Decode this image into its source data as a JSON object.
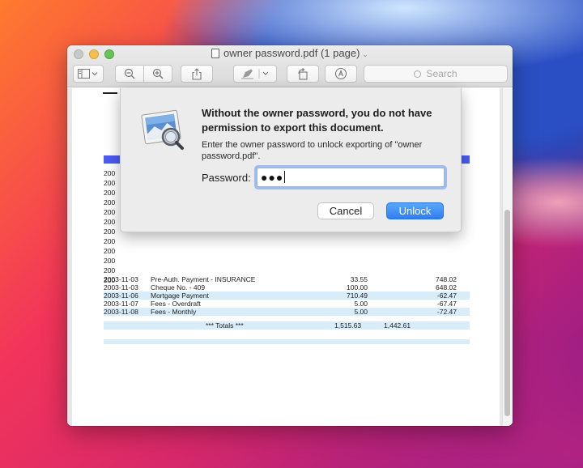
{
  "window": {
    "title": "owner password.pdf (1 page)",
    "search_placeholder": "Search"
  },
  "toolbar": {
    "sidebar_icon": "sidebar-icon",
    "zoom_out_icon": "zoom-out-icon",
    "zoom_in_icon": "zoom-in-icon",
    "share_icon": "share-icon",
    "markup_icon": "highlighter-icon",
    "rotate_icon": "rotate-icon",
    "annotate_icon": "markup-pen-icon"
  },
  "dialog": {
    "title": "Without the owner password, you do not have permission to export this document.",
    "message": "Enter the owner password to unlock exporting of \"owner password.pdf\".",
    "password_label": "Password:",
    "password_value": "●●●",
    "cancel_label": "Cancel",
    "unlock_label": "Unlock"
  },
  "document": {
    "hidden_rows_prefix": [
      "200",
      "200",
      "200",
      "200",
      "200",
      "200",
      "200",
      "200",
      "200",
      "200",
      "200",
      "200"
    ],
    "rows": [
      {
        "date": "2003-11-03",
        "desc": "Pre-Auth. Payment - INSURANCE",
        "amount": "33.55",
        "balance": "748.02"
      },
      {
        "date": "2003-11-03",
        "desc": "Cheque No. - 409",
        "amount": "100.00",
        "balance": "648.02"
      },
      {
        "date": "2003-11-06",
        "desc": "Mortgage Payment",
        "amount": "710.49",
        "balance": "-62.47"
      },
      {
        "date": "2003-11-07",
        "desc": "Fees - Overdraft",
        "amount": "5.00",
        "balance": "-67.47"
      },
      {
        "date": "2003-11-08",
        "desc": "Fees - Monthly",
        "amount": "5.00",
        "balance": "-72.47"
      }
    ],
    "totals_label": "*** Totals ***",
    "totals_debit": "1,515.63",
    "totals_credit": "1,442.61"
  },
  "colors": {
    "header_bar": "#4b5cf0",
    "row_band": "#d9ecf9",
    "unlock_button": "#2f7ef2"
  }
}
